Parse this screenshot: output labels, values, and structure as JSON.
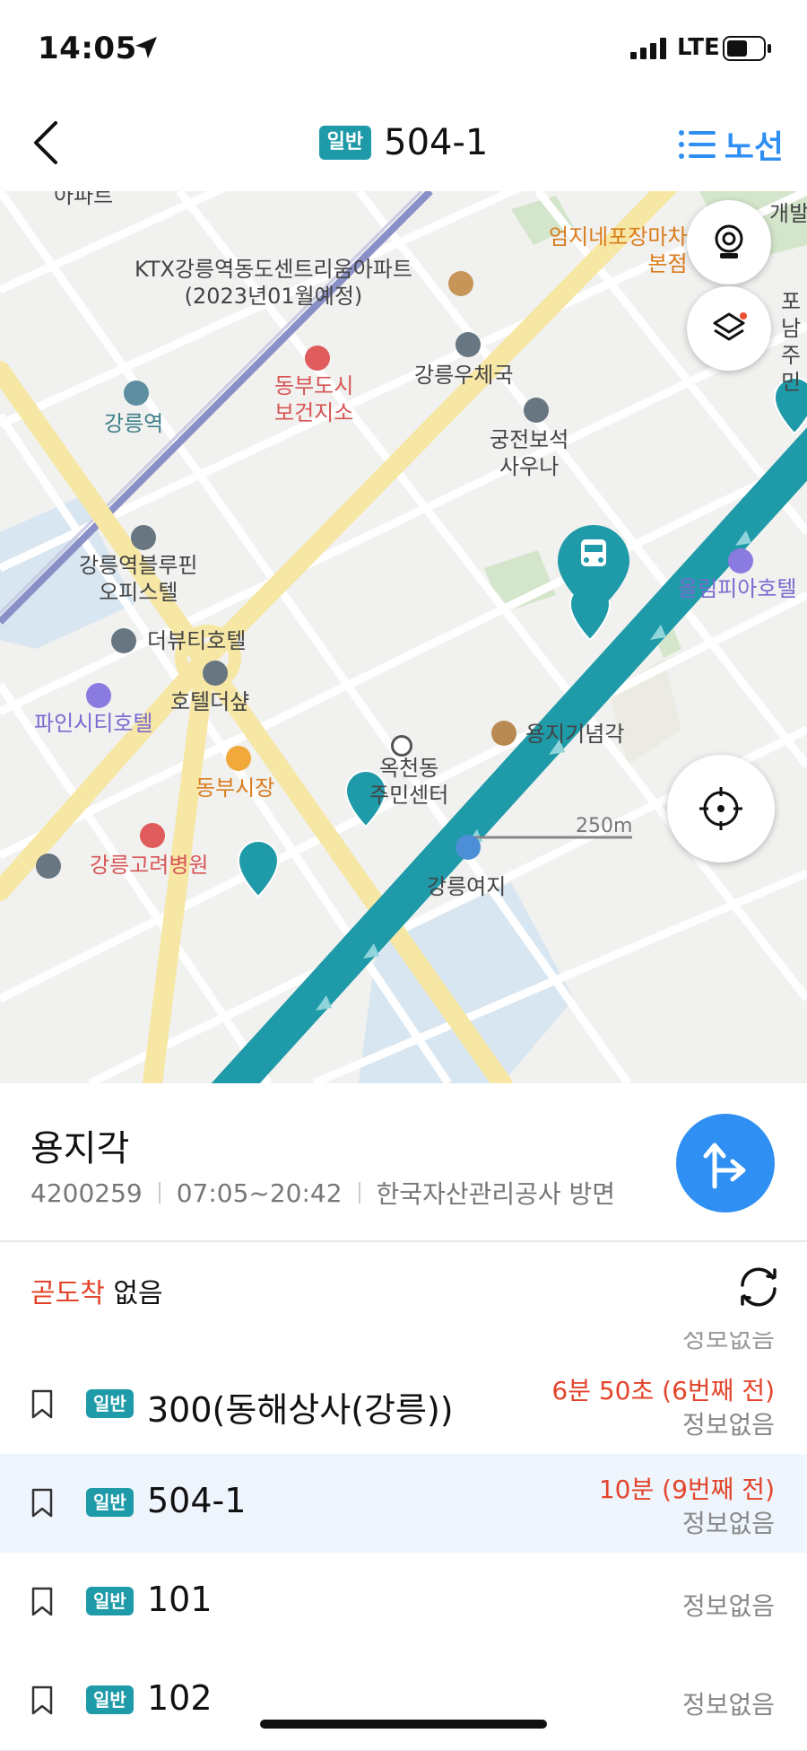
{
  "status_bar": {
    "time": "14:05",
    "network": "LTE"
  },
  "header": {
    "badge": "일반",
    "title": "504-1",
    "route_button": "노선"
  },
  "map": {
    "labels": {
      "apt_top": "아파트",
      "gaebal": "개발",
      "ktx_apt": "KTX강릉역동도센트리움아파트\n(2023년01월예정)",
      "market_name": "엄지네포장마차\n본점",
      "ponam": "포남\n주민",
      "health_center": "동부도시\n보건지소",
      "post_office": "강릉우체국",
      "station": "강릉역",
      "sauna": "궁전보석\n사우나",
      "bluepin": "강릉역블루핀\n오피스텔",
      "olympia": "올림피아호텔",
      "the_beauty": "더뷰티호텔",
      "hotel_the_shine": "호텔더샾",
      "pinecity": "파인시티호텔",
      "yongji": "용지기념각",
      "okcheon": "옥천동\n주민센터",
      "dongbu_market": "동부시장",
      "hospital": "강릉고려병원",
      "bottom_cut": "강릉여지"
    },
    "scale_label": "250m"
  },
  "stop": {
    "name": "용지각",
    "id": "4200259",
    "hours": "07:05~20:42",
    "direction": "한국자산관리공사 방면"
  },
  "arrival_soon": {
    "label": "곧도착",
    "value": "없음"
  },
  "partial_row_text": "정보없음",
  "buses": [
    {
      "badge": "일반",
      "route": "300(동해상사(강릉))",
      "eta": "6분 50초 (6번째 전)",
      "info": "정보없음",
      "selected": false
    },
    {
      "badge": "일반",
      "route": "504-1",
      "eta": "10분 (9번째 전)",
      "info": "정보없음",
      "selected": true
    },
    {
      "badge": "일반",
      "route": "101",
      "eta": "",
      "info": "정보없음",
      "selected": false
    },
    {
      "badge": "일반",
      "route": "102",
      "eta": "",
      "info": "정보없음",
      "selected": false
    }
  ],
  "colors": {
    "accent_blue": "#2f8ff2",
    "route_teal": "#1f9aa8",
    "eta_red": "#e3452c",
    "selected_row_bg": "#eef5fd"
  }
}
